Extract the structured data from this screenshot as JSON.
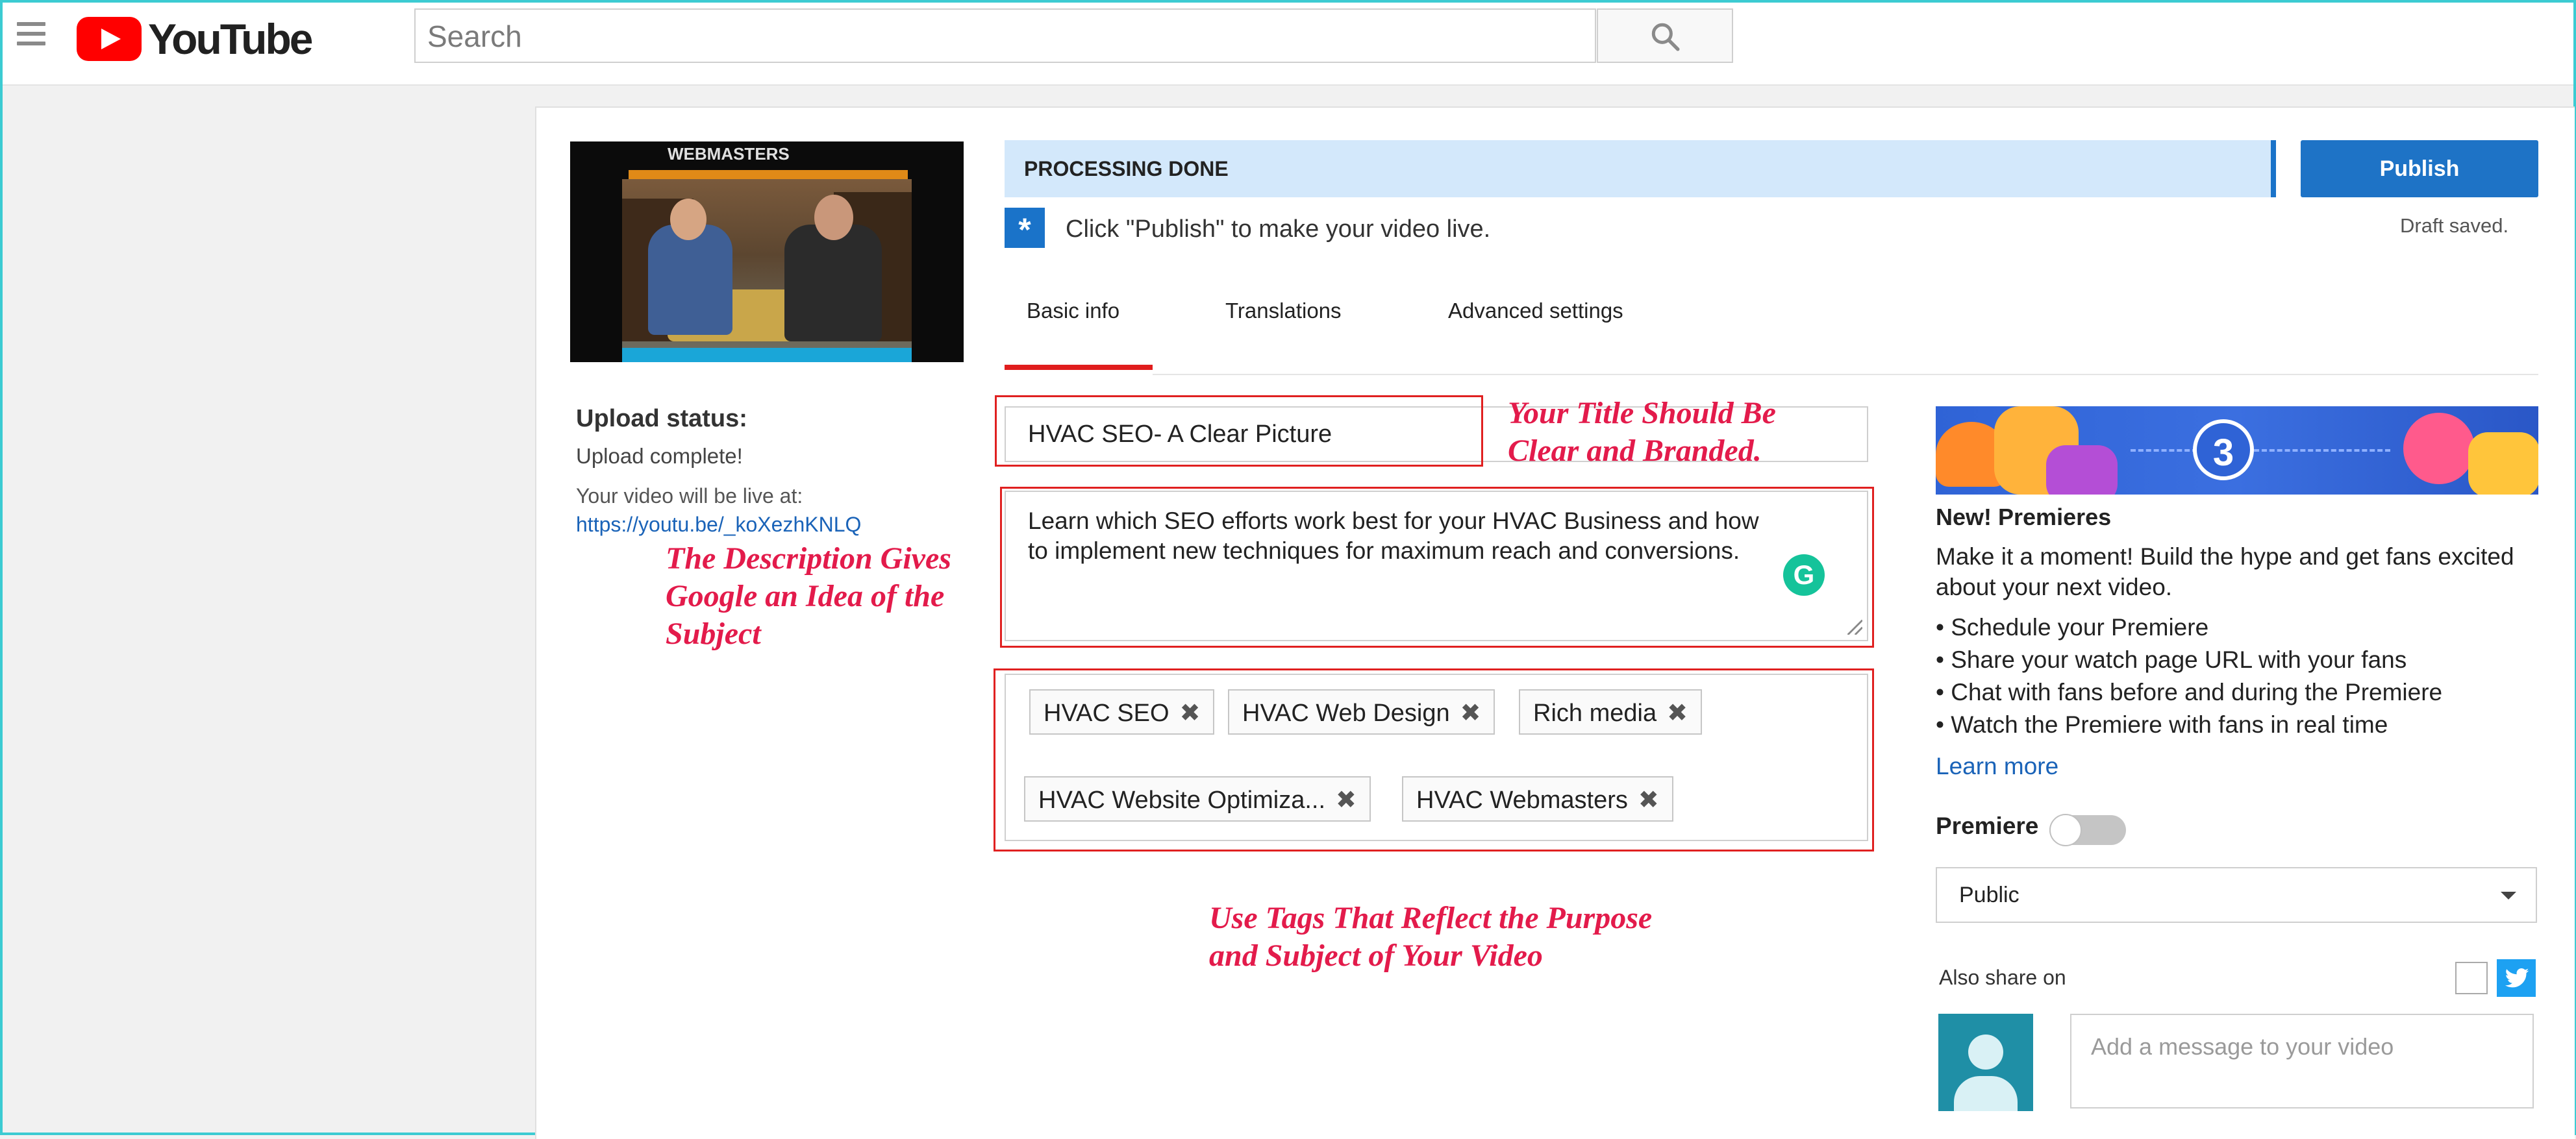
{
  "header": {
    "logo_text": "YouTube",
    "search_placeholder": "Search"
  },
  "video": {
    "thumbnail_logo_text": "WEBMASTERS",
    "upload_status_label": "Upload status:",
    "upload_complete": "Upload complete!",
    "live_at_label": "Your video will be live at:",
    "live_url": "https://youtu.be/_koXezhKNLQ"
  },
  "status": {
    "processing": "PROCESSING DONE",
    "hint": "Click \"Publish\" to make your video live.",
    "publish_label": "Publish",
    "draft_saved": "Draft saved."
  },
  "tabs": [
    {
      "label": "Basic info",
      "active": true
    },
    {
      "label": "Translations",
      "active": false
    },
    {
      "label": "Advanced settings",
      "active": false
    }
  ],
  "form": {
    "title_value": "HVAC SEO- A Clear Picture",
    "description_line1": "Learn which SEO efforts work best for your HVAC Business and how",
    "description_line2": "to implement new techniques for maximum reach and conversions.",
    "tags": [
      {
        "label": "HVAC SEO"
      },
      {
        "label": "HVAC Web Design"
      },
      {
        "label": "Rich media"
      },
      {
        "label": "HVAC Website Optimiza..."
      },
      {
        "label": "HVAC Webmasters"
      }
    ],
    "tag_remove_glyph": "✖"
  },
  "annotations": {
    "title_line1": "Your Title Should Be",
    "title_line2": "Clear and Branded.",
    "desc_line1": "The Description Gives",
    "desc_line2": "Google an Idea of the",
    "desc_line3": "Subject",
    "tags_line1": "Use Tags That Reflect the Purpose",
    "tags_line2": "and Subject of Your Video",
    "color": "#e31b4b"
  },
  "premieres": {
    "banner_number": "3",
    "title": "New! Premieres",
    "description": "Make it a moment! Build the hype and get fans excited about your next video.",
    "bullets": [
      "• Schedule your Premiere",
      "• Share your watch page URL with your fans",
      "• Chat with fans before and during the Premiere",
      "• Watch the Premiere with fans in real time"
    ],
    "learn_more": "Learn more",
    "premiere_label": "Premiere",
    "premiere_enabled": false,
    "visibility": "Public",
    "also_share_on": "Also share on",
    "message_placeholder": "Add a message to your video"
  },
  "colors": {
    "accent_blue": "#1e73c6",
    "tab_active_red": "#e01d1d",
    "link_blue": "#1a63b8",
    "frame_cyan": "#3ccbd2"
  },
  "icons": [
    "hamburger-menu-icon",
    "youtube-play-icon",
    "search-icon",
    "info-star-icon",
    "grammarly-icon",
    "resize-handle-icon",
    "dropdown-caret-icon",
    "twitter-icon",
    "avatar-icon"
  ]
}
